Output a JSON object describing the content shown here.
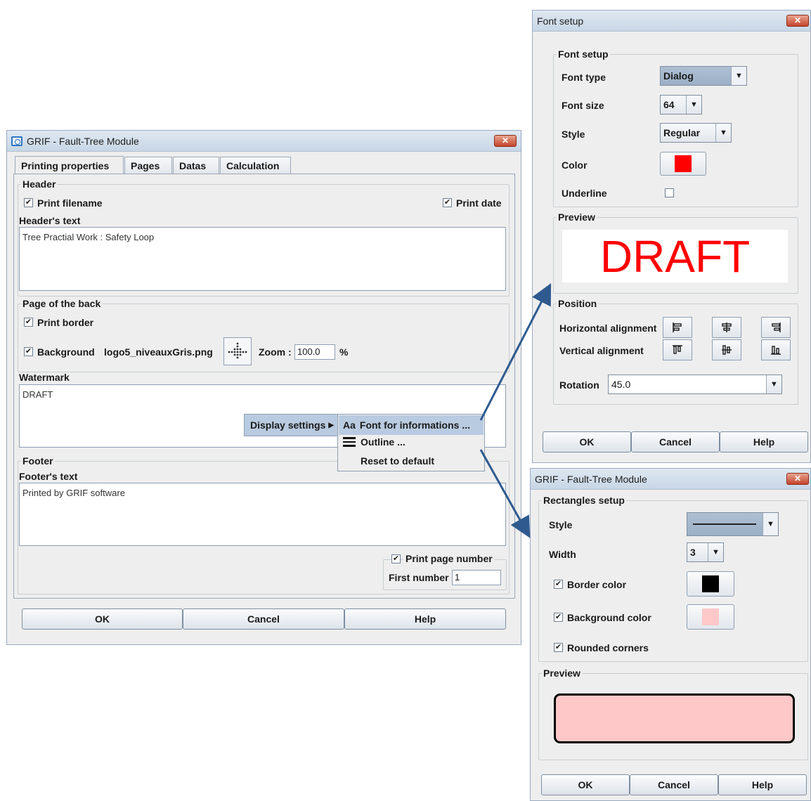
{
  "main": {
    "title": "GRIF - Fault-Tree Module",
    "close": "✕",
    "tabs": [
      "Printing properties",
      "Pages",
      "Datas",
      "Calculation"
    ],
    "header": {
      "group": "Header",
      "print_filename": "Print filename",
      "print_date": "Print date",
      "text_label": "Header's text",
      "text_value": "Tree Practial Work : Safety Loop"
    },
    "back": {
      "group": "Page of the back",
      "print_border": "Print border",
      "background": "Background",
      "bg_file": "logo5_niveauxGris.png",
      "zoom_label": "Zoom :",
      "zoom_value": "100.0",
      "zoom_unit": "%"
    },
    "watermark": {
      "label": "Watermark",
      "value": "DRAFT"
    },
    "footer": {
      "group": "Footer",
      "text_label": "Footer's text",
      "text_value": "Printed by GRIF software",
      "print_page_number": "Print page number",
      "first_number_label": "First number",
      "first_number_value": "1"
    },
    "buttons": {
      "ok": "OK",
      "cancel": "Cancel",
      "help": "Help"
    }
  },
  "context_menu": {
    "display_settings": "Display settings",
    "items": [
      {
        "icon": "Aa",
        "label": "Font for informations ..."
      },
      {
        "label": "Outline ..."
      },
      {
        "label": "Reset to default"
      }
    ]
  },
  "font_dialog": {
    "title": "Font setup",
    "close": "✕",
    "group": "Font setup",
    "font_type_label": "Font type",
    "font_type_value": "Dialog",
    "font_size_label": "Font size",
    "font_size_value": "64",
    "style_label": "Style",
    "style_value": "Regular",
    "color_label": "Color",
    "color_value": "#ff0000",
    "underline_label": "Underline",
    "preview_group": "Preview",
    "preview_text": "DRAFT",
    "position_group": "Position",
    "h_align_label": "Horizontal alignment",
    "v_align_label": "Vertical alignment",
    "rotation_label": "Rotation",
    "rotation_value": "45.0",
    "buttons": {
      "ok": "OK",
      "cancel": "Cancel",
      "help": "Help"
    }
  },
  "rect_dialog": {
    "title": "GRIF - Fault-Tree Module",
    "close": "✕",
    "group": "Rectangles setup",
    "style_label": "Style",
    "width_label": "Width",
    "width_value": "3",
    "border_color": "Border color",
    "border_color_value": "#000000",
    "background_color": "Background color",
    "background_color_value": "#ffc8c8",
    "rounded_corners": "Rounded corners",
    "preview_group": "Preview",
    "buttons": {
      "ok": "OK",
      "cancel": "Cancel",
      "help": "Help"
    }
  }
}
